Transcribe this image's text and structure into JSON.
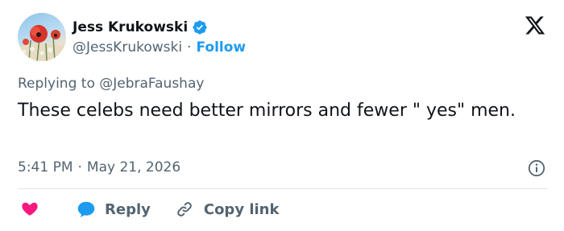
{
  "tweet": {
    "author": {
      "display_name": "Jess Krukowski",
      "handle": "@JessKrukowski",
      "verified": true,
      "avatar_icon": "poppy-field-avatar"
    },
    "header": {
      "separator": "·",
      "follow_label": "Follow",
      "platform_icon": "x-logo-icon"
    },
    "replying_to": {
      "prefix": "Replying to",
      "handle": "@JebraFaushay"
    },
    "text": "These celebs need better mirrors and fewer \" yes\" men.",
    "time": "5:41 PM",
    "date": "May 21, 2026",
    "meta_separator": "·",
    "info_icon": "info-icon",
    "actions": {
      "like_icon": "heart-icon",
      "reply_label": "Reply",
      "reply_icon": "speech-bubble-icon",
      "copy_label": "Copy link",
      "copy_icon": "link-icon"
    }
  },
  "colors": {
    "link_blue": "#1d9bf0",
    "text_primary": "#0f1419",
    "text_secondary": "#536471",
    "like_pink": "#f91880",
    "divider": "#e1e6ea"
  }
}
